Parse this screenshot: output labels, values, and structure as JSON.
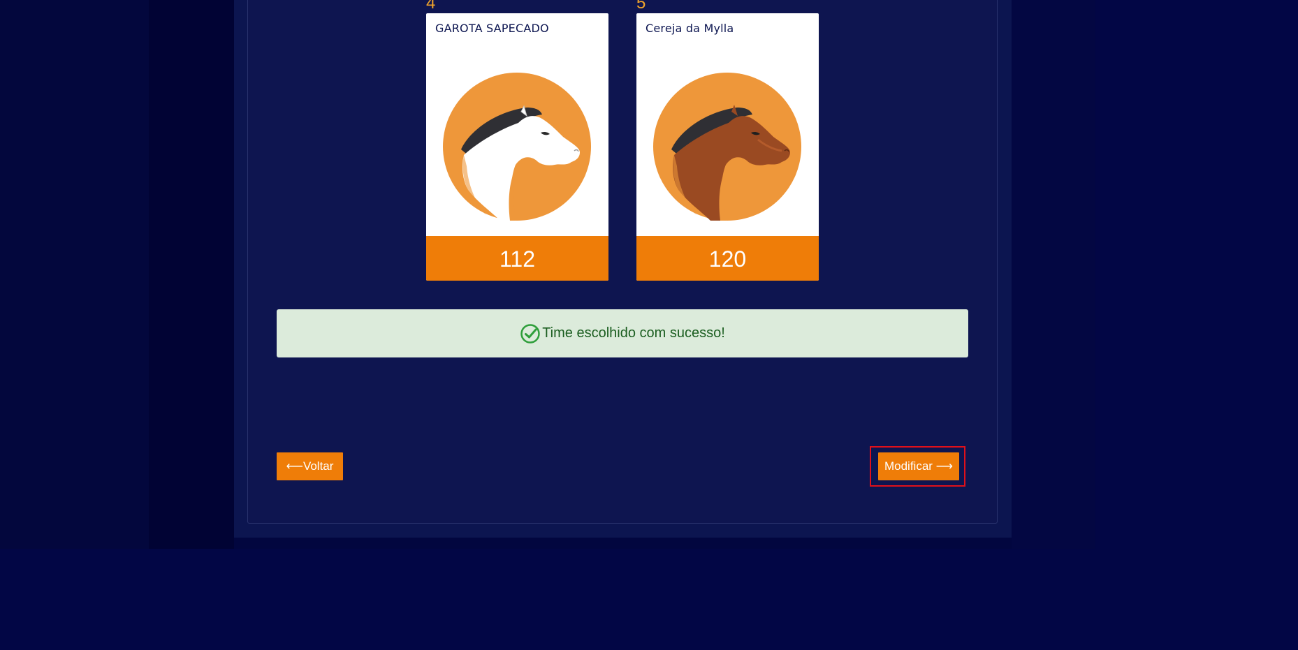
{
  "cards": [
    {
      "number": "4",
      "name": "GAROTA SAPECADO",
      "score": "112",
      "horse_color": "white"
    },
    {
      "number": "5",
      "name": "Cereja da Mylla",
      "score": "120",
      "horse_color": "brown"
    }
  ],
  "alert": {
    "message": "Time escolhido com sucesso!",
    "icon": "check-circle-icon",
    "color": "#1b5e20"
  },
  "buttons": {
    "back_label": "⟵Voltar",
    "modify_label": "Modificar ⟶"
  },
  "colors": {
    "accent": "#ef7d08",
    "number_color": "#f2a52b",
    "background": "#0c1550",
    "highlight": "#e0101a"
  }
}
